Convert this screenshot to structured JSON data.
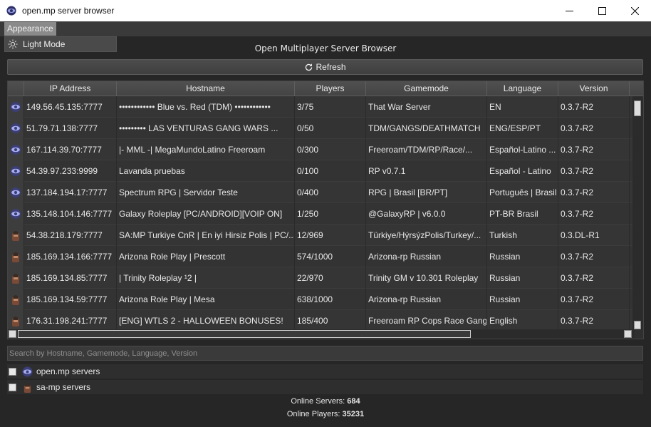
{
  "window": {
    "title": "open.mp server browser",
    "icon": "ompeye-icon",
    "buttons": [
      "minimize-icon",
      "maximize-icon",
      "close-icon"
    ]
  },
  "menu": {
    "appearance": "Appearance",
    "light_mode": "Light Mode"
  },
  "heading": "Open Multiplayer Server Browser",
  "refresh_label": "Refresh",
  "table": {
    "columns": [
      "IP Address",
      "Hostname",
      "Players",
      "Gamemode",
      "Language",
      "Version"
    ],
    "rows": [
      {
        "icon": "openmp",
        "ip": "149.56.45.135:7777",
        "hostname": "•••••••••••• Blue vs. Red (TDM) ••••••••••••",
        "players": "3/75",
        "gamemode": "That War Server",
        "language": "EN",
        "version": "0.3.7-R2"
      },
      {
        "icon": "openmp",
        "ip": "51.79.71.138:7777",
        "hostname": "••••••••• LAS VENTURAS GANG WARS ...",
        "players": "0/50",
        "gamemode": "TDM/GANGS/DEATHMATCH",
        "language": "ENG/ESP/PT",
        "version": "0.3.7-R2"
      },
      {
        "icon": "openmp",
        "ip": "167.114.39.70:7777",
        "hostname": "        |- MML -|  MegaMundoLatino  Freeroam",
        "players": "0/300",
        "gamemode": "Freeroam/TDM/RP/Race/...",
        "language": "Español-Latino ...",
        "version": "0.3.7-R2"
      },
      {
        "icon": "openmp",
        "ip": "54.39.97.233:9999",
        "hostname": "Lavanda pruebas",
        "players": "0/100",
        "gamemode": "RP v0.7.1",
        "language": "Español - Latino",
        "version": "0.3.7-R2"
      },
      {
        "icon": "openmp",
        "ip": "137.184.194.17:7777",
        "hostname": "Spectrum RPG | Servidor Teste",
        "players": "0/400",
        "gamemode": "RPG | Brasil [BR/PT]",
        "language": "Português | Brasil",
        "version": "0.3.7-R2"
      },
      {
        "icon": "openmp",
        "ip": "135.148.104.146:7777",
        "hostname": "Galaxy Roleplay [PC/ANDROID][VOIP ON]",
        "players": "1/250",
        "gamemode": "@GalaxyRP | v6.0.0",
        "language": "PT-BR Brasil",
        "version": "0.3.7-R2"
      },
      {
        "icon": "samp",
        "ip": "54.38.218.179:7777",
        "hostname": "SA:MP Turkiye CnR | En iyi Hirsiz Polis | PC/...",
        "players": "12/969",
        "gamemode": "Türkiye/HýrsýzPolis/Turkey/...",
        "language": "Turkish",
        "version": "0.3.DL-R1"
      },
      {
        "icon": "samp",
        "ip": "185.169.134.166:7777",
        "hostname": "Arizona Role Play | Prescott",
        "players": "574/1000",
        "gamemode": "Arizona-rp Russian",
        "language": "Russian",
        "version": "0.3.7-R2"
      },
      {
        "icon": "samp",
        "ip": "185.169.134.85:7777",
        "hostname": "|       Trinity Roleplay  ¹2      |",
        "players": "22/970",
        "gamemode": "Trinity GM v 10.301 Roleplay",
        "language": "Russian",
        "version": "0.3.7-R2"
      },
      {
        "icon": "samp",
        "ip": "185.169.134.59:7777",
        "hostname": "Arizona Role Play | Mesa",
        "players": "638/1000",
        "gamemode": "Arizona-rp Russian",
        "language": "Russian",
        "version": "0.3.7-R2"
      },
      {
        "icon": "samp",
        "ip": "176.31.198.241:7777",
        "hostname": "[ENG] WTLS 2 - HALLOWEEN BONUSES!",
        "players": "185/400",
        "gamemode": "Freeroam RP Cops Race Gangs",
        "language": "English",
        "version": "0.3.7-R2"
      }
    ]
  },
  "search": {
    "placeholder": "Search by Hostname, Gamemode, Language, Version",
    "value": ""
  },
  "filters": [
    {
      "label": "open.mp servers",
      "icon": "openmp-logo-icon",
      "checked": false
    },
    {
      "label": "sa-mp servers",
      "icon": "samp-logo-icon",
      "checked": false
    }
  ],
  "stats": {
    "online_servers_label": "Online Servers:",
    "online_servers": "684",
    "online_players_label": "Online Players:",
    "online_players": "35231"
  }
}
